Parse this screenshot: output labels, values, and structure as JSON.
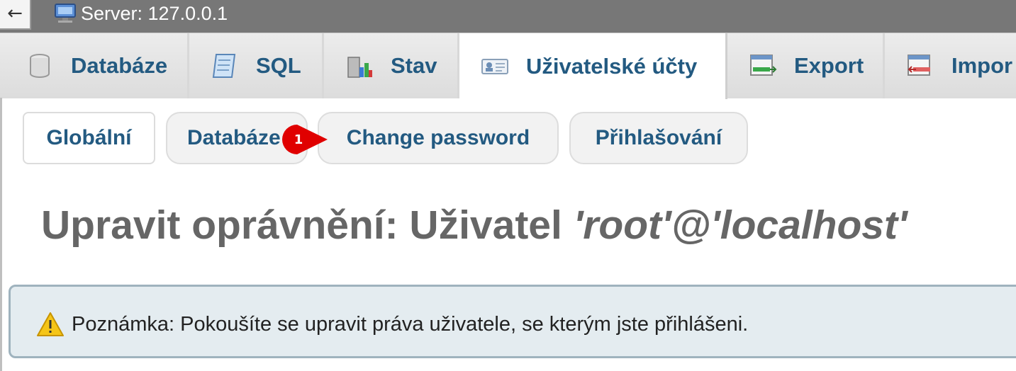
{
  "topbar": {
    "back_glyph": "←",
    "server_icon": "server-icon",
    "server_label": "Server: 127.0.0.1"
  },
  "tabs": [
    {
      "label": "Databáze",
      "icon": "database-icon",
      "active": false
    },
    {
      "label": "SQL",
      "icon": "sql-icon",
      "active": false
    },
    {
      "label": "Stav",
      "icon": "status-chart-icon",
      "active": false
    },
    {
      "label": "Uživatelské účty",
      "icon": "user-accounts-icon",
      "active": true
    },
    {
      "label": "Export",
      "icon": "export-icon",
      "active": false
    },
    {
      "label": "Impor",
      "icon": "import-icon",
      "active": false
    }
  ],
  "subtabs": [
    {
      "label": "Globální",
      "active": true
    },
    {
      "label": "Databáze",
      "active": false
    },
    {
      "label": "Change password",
      "active": false
    },
    {
      "label": "Přihlašování",
      "active": false
    }
  ],
  "marker": {
    "number": "1",
    "color": "#e00000"
  },
  "title": {
    "prefix": "Upravit oprávnění: Uživatel ",
    "user": "'root'@'localhost'"
  },
  "notice": {
    "icon": "warning-icon",
    "text": "Poznámka: Pokoušíte se upravit práva uživatele, se kterým jste přihlášeni."
  },
  "colors": {
    "link": "#235a81",
    "topbar": "#777777",
    "notice_bg": "#e4ecf0",
    "marker": "#e00000"
  }
}
